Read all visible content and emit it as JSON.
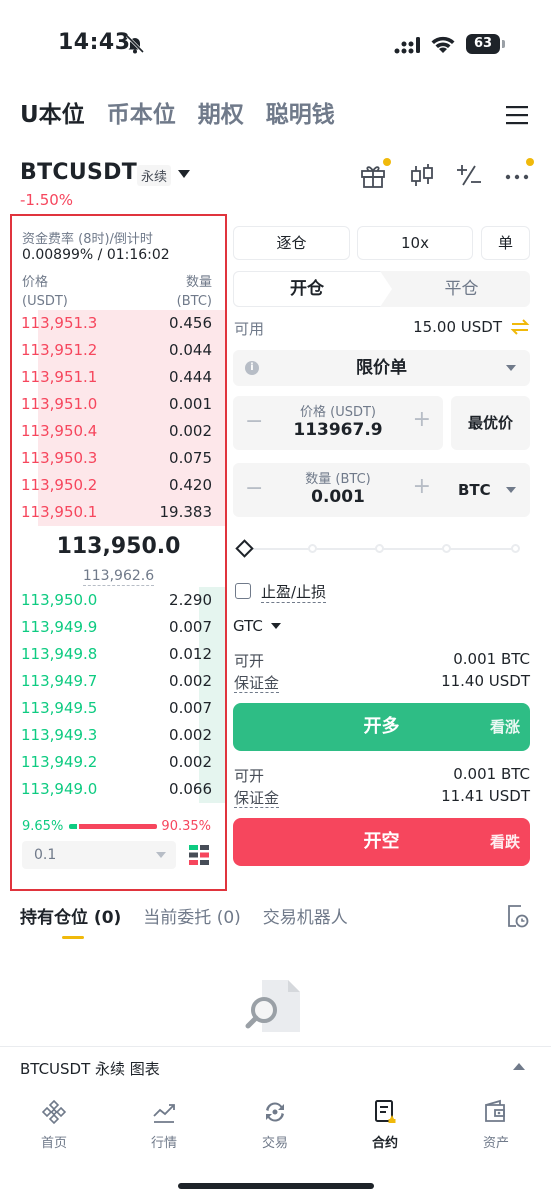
{
  "status": {
    "time": "14:43",
    "battery": "63"
  },
  "product_tabs": [
    "U本位",
    "币本位",
    "期权",
    "聪明钱"
  ],
  "symbol": {
    "name": "BTCUSDT",
    "badge": "永续",
    "change": "-1.50%"
  },
  "orderbook": {
    "funding_label": "资金费率 (8时)/倒计时",
    "funding_value": "0.00899% / 01:16:02",
    "price_header": "价格",
    "price_unit": "(USDT)",
    "qty_header": "数量",
    "qty_unit": "(BTC)",
    "asks": [
      {
        "price": "113,951.3",
        "qty": "0.456",
        "depth": 0.88
      },
      {
        "price": "113,951.2",
        "qty": "0.044",
        "depth": 0.88
      },
      {
        "price": "113,951.1",
        "qty": "0.444",
        "depth": 0.88
      },
      {
        "price": "113,951.0",
        "qty": "0.001",
        "depth": 0.88
      },
      {
        "price": "113,950.4",
        "qty": "0.002",
        "depth": 0.88
      },
      {
        "price": "113,950.3",
        "qty": "0.075",
        "depth": 0.88
      },
      {
        "price": "113,950.2",
        "qty": "0.420",
        "depth": 0.88
      },
      {
        "price": "113,950.1",
        "qty": "19.383",
        "depth": 0.88
      }
    ],
    "last_price": "113,950.0",
    "mark_price": "113,962.6",
    "bids": [
      {
        "price": "113,950.0",
        "qty": "2.290",
        "depth": 0.12
      },
      {
        "price": "113,949.9",
        "qty": "0.007",
        "depth": 0.12
      },
      {
        "price": "113,949.8",
        "qty": "0.012",
        "depth": 0.12
      },
      {
        "price": "113,949.7",
        "qty": "0.002",
        "depth": 0.12
      },
      {
        "price": "113,949.5",
        "qty": "0.007",
        "depth": 0.12
      },
      {
        "price": "113,949.3",
        "qty": "0.002",
        "depth": 0.12
      },
      {
        "price": "113,949.2",
        "qty": "0.002",
        "depth": 0.12
      },
      {
        "price": "113,949.0",
        "qty": "0.066",
        "depth": 0.12
      }
    ],
    "buy_ratio": "9.65%",
    "sell_ratio": "90.35%",
    "buy_fraction": 0.0965,
    "step": "0.1"
  },
  "order_panel": {
    "margin_mode": "逐仓",
    "leverage": "10x",
    "position_mode": "单",
    "open_tab": "开仓",
    "close_tab": "平仓",
    "available_label": "可用",
    "available_value": "15.00 USDT",
    "order_type": "限价单",
    "price_label": "价格 (USDT)",
    "price_value": "113967.9",
    "best_price": "最优价",
    "qty_label": "数量 (BTC)",
    "qty_value": "0.001",
    "qty_unit": "BTC",
    "tpsl_label": "止盈/止损",
    "tif": "GTC",
    "long": {
      "max_label": "可开",
      "max_value": "0.001 BTC",
      "margin_label": "保证金",
      "margin_value": "11.40 USDT",
      "button": "开多",
      "hint": "看涨"
    },
    "short": {
      "max_label": "可开",
      "max_value": "0.001 BTC",
      "margin_label": "保证金",
      "margin_value": "11.41 USDT",
      "button": "开空",
      "hint": "看跌"
    }
  },
  "positions_tabs": [
    "持有仓位 (0)",
    "当前委托 (0)",
    "交易机器人"
  ],
  "chart_bar_label": "BTCUSDT 永续  图表",
  "nav": [
    "首页",
    "行情",
    "交易",
    "合约",
    "资产"
  ],
  "colors": {
    "buy": "#0ecb81",
    "sell": "#f6465d",
    "accent": "#f0b90b",
    "long_button": "#2ebd85"
  }
}
